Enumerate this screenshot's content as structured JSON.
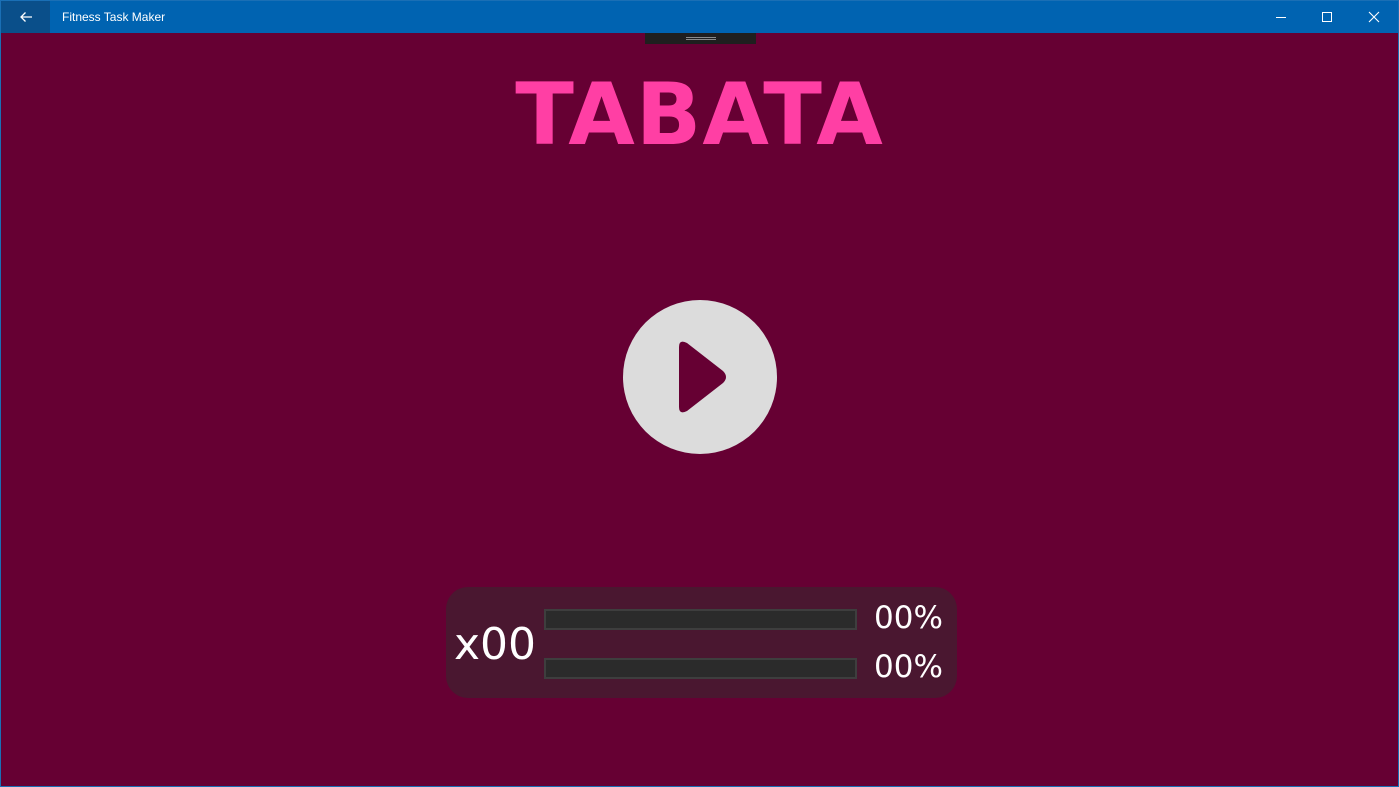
{
  "window": {
    "app_title": "Fitness Task Maker",
    "controls": {
      "back": "back-arrow-icon",
      "minimize": "minimize-icon",
      "maximize": "maximize-icon",
      "close": "close-icon"
    }
  },
  "workout": {
    "title": "TABATA",
    "play_icon": "play-icon"
  },
  "progress": {
    "rounds_label": "x00",
    "bar1_percent_label": "00%",
    "bar1_value": 0,
    "bar2_percent_label": "00%",
    "bar2_value": 0
  },
  "colors": {
    "titlebar": "#0063b1",
    "background": "#660033",
    "accent": "#ff3fa4",
    "play_button": "#dcdcdc",
    "panel": "#4a1730"
  }
}
